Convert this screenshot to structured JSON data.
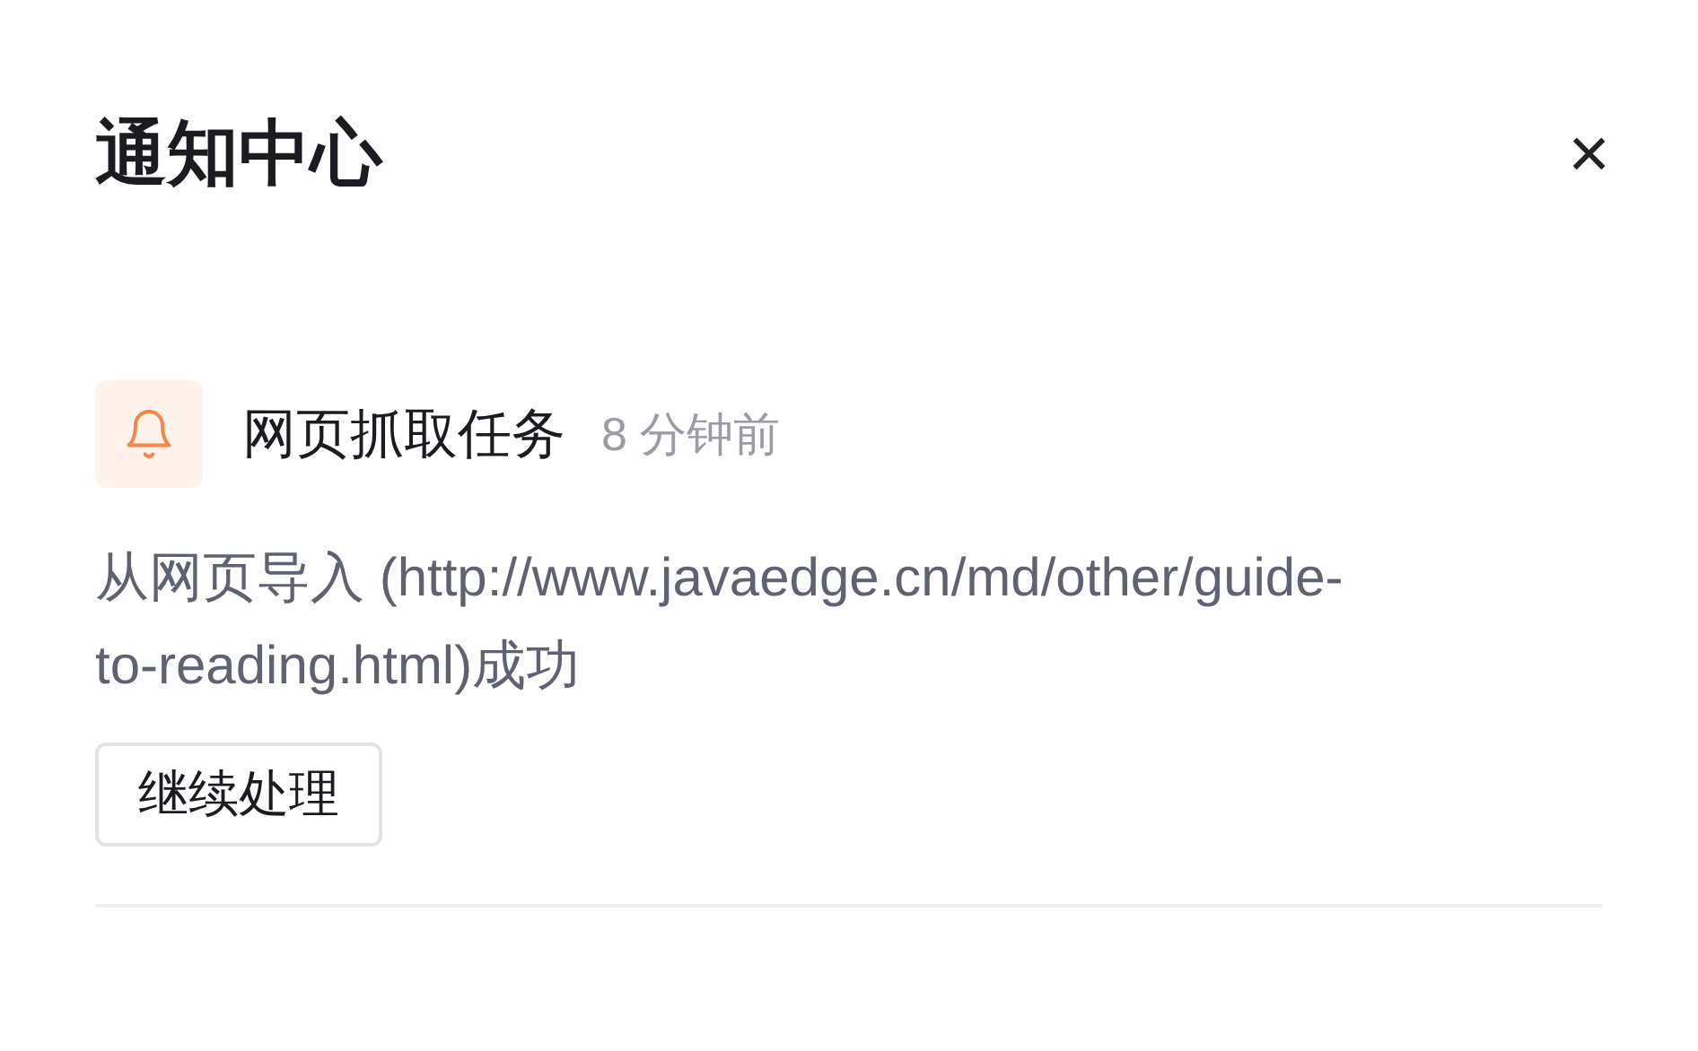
{
  "panel": {
    "title": "通知中心",
    "close": "×"
  },
  "notifications": [
    {
      "kind": "task",
      "title": "网页抓取任务",
      "time": "8 分钟前",
      "message": "从网页导入 (http://www.javaedge.cn/md/other/guide-to-reading.html)成功",
      "action": "继续处理"
    }
  ]
}
